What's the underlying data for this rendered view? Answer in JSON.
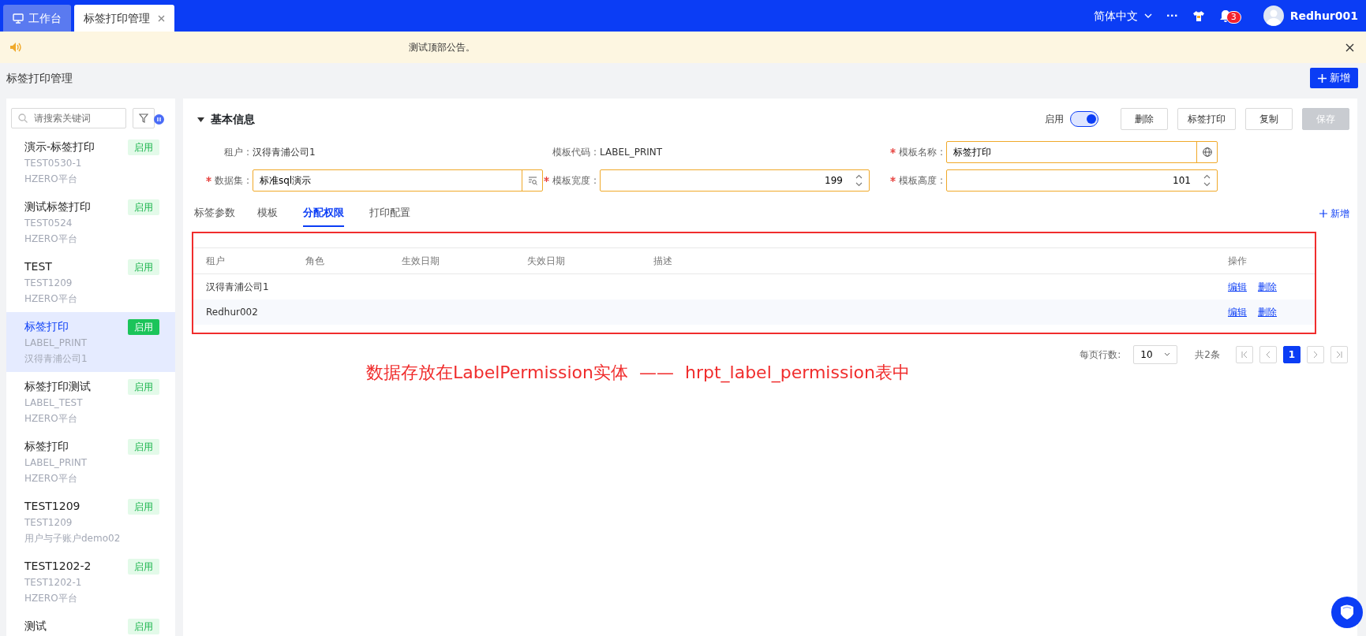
{
  "top_tabs": [
    {
      "label": "工作台",
      "selected": false,
      "closable": false
    },
    {
      "label": "标签打印管理",
      "selected": true,
      "closable": true
    }
  ],
  "header": {
    "language": "简体中文",
    "more": "···",
    "notification_count": "3",
    "user": "Redhur001"
  },
  "notice": {
    "text": "测试顶部公告。"
  },
  "page": {
    "title": "标签打印管理",
    "add_button": "新增"
  },
  "sidebar": {
    "search_placeholder": "请搜索关键词",
    "items": [
      {
        "title": "演示-标签打印",
        "code": "TEST0530-1",
        "tenant": "HZERO平台",
        "status": "启用",
        "selected": false
      },
      {
        "title": "测试标签打印",
        "code": "TEST0524",
        "tenant": "HZERO平台",
        "status": "启用",
        "selected": false
      },
      {
        "title": "TEST",
        "code": "TEST1209",
        "tenant": "HZERO平台",
        "status": "启用",
        "selected": false
      },
      {
        "title": "标签打印",
        "code": "LABEL_PRINT",
        "tenant": "汉得青浦公司1",
        "status": "启用",
        "selected": true
      },
      {
        "title": "标签打印测试",
        "code": "LABEL_TEST",
        "tenant": "HZERO平台",
        "status": "启用",
        "selected": false
      },
      {
        "title": "标签打印",
        "code": "LABEL_PRINT",
        "tenant": "HZERO平台",
        "status": "启用",
        "selected": false
      },
      {
        "title": "TEST1209",
        "code": "TEST1209",
        "tenant": "用户与子账户demo02",
        "status": "启用",
        "selected": false
      },
      {
        "title": "TEST1202-2",
        "code": "TEST1202-1",
        "tenant": "HZERO平台",
        "status": "启用",
        "selected": false
      },
      {
        "title": "测试",
        "status": "启用",
        "selected": false
      }
    ]
  },
  "basic_info": {
    "title": "基本信息",
    "expanded": true,
    "enabled_label": "启用",
    "enabled": true,
    "buttons": [
      {
        "label": "删除",
        "disabled": false
      },
      {
        "label": "标签打印",
        "disabled": false
      },
      {
        "label": "复制",
        "disabled": false
      },
      {
        "label": "保存",
        "disabled": true
      }
    ],
    "fields": [
      {
        "label": "租户 :",
        "required": false,
        "kind": "text",
        "value": "汉得青浦公司1"
      },
      {
        "label": "模板代码 :",
        "required": false,
        "kind": "text",
        "value": "LABEL_PRINT"
      },
      {
        "label": "模板名称 :",
        "required": true,
        "kind": "i18n",
        "value": "标签打印"
      },
      {
        "label": "数据集 :",
        "required": true,
        "kind": "lookup",
        "value": "标准sql演示"
      },
      {
        "label": "模板宽度 :",
        "required": true,
        "kind": "number",
        "value": "199"
      },
      {
        "label": "模板高度 :",
        "required": true,
        "kind": "number",
        "value": "101"
      }
    ]
  },
  "detail_tabs": [
    {
      "label": "标签参数",
      "selected": false
    },
    {
      "label": "模板",
      "selected": false
    },
    {
      "label": "分配权限",
      "selected": true
    },
    {
      "label": "打印配置",
      "selected": false
    }
  ],
  "detail_add": "新增",
  "table": {
    "columns": [
      "租户",
      "角色",
      "生效日期",
      "失效日期",
      "描述",
      "操作"
    ],
    "rows": [
      {
        "tenant": "汉得青浦公司1",
        "actions": [
          "编辑",
          "删除"
        ]
      },
      {
        "tenant": "Redhur002",
        "actions": [
          "编辑",
          "删除"
        ]
      }
    ]
  },
  "pagination": {
    "page_size_label": "每页行数:",
    "page_size": "10",
    "total": "共2条",
    "pages": [
      {
        "label": "1",
        "selected": true
      }
    ]
  },
  "annotation": {
    "text": "数据存放在LabelPermission实体  ——  hrpt_label_permission表中"
  }
}
